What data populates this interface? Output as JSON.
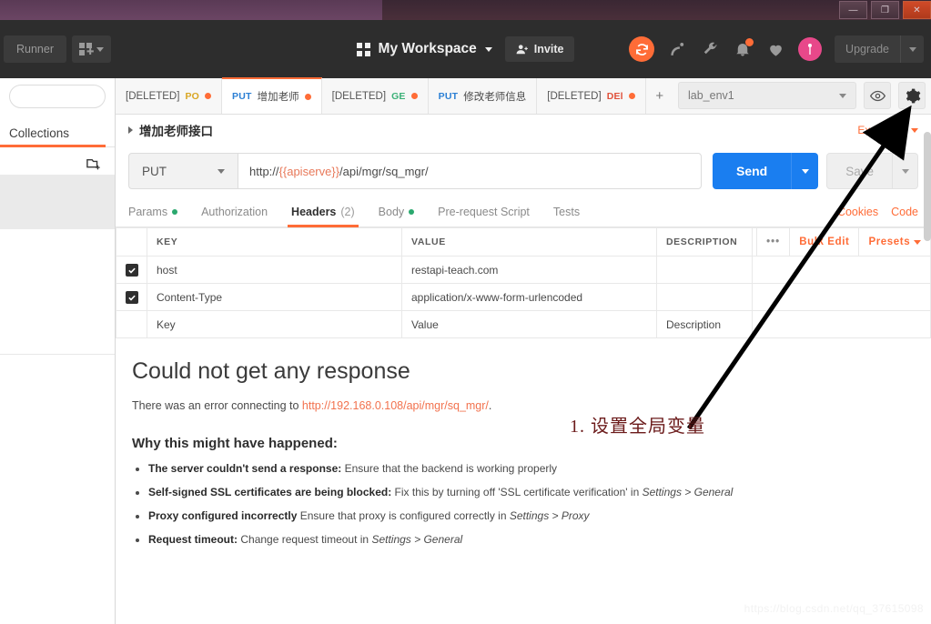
{
  "os_window": {
    "buttons": [
      {
        "name": "minimize",
        "glyph": "—"
      },
      {
        "name": "maximize",
        "glyph": "❐"
      },
      {
        "name": "close",
        "glyph": "✕"
      }
    ]
  },
  "header": {
    "runner_label": "Runner",
    "import_label": "",
    "workspace_label": "My Workspace",
    "invite_label": "Invite",
    "upgrade_label": "Upgrade",
    "icons": [
      "sync-icon",
      "satellite-icon",
      "wrench-icon",
      "bell-icon",
      "heart-icon",
      "avatar-icon"
    ],
    "accent_orange": "#ff6c37",
    "avatar_color": "#e8488a"
  },
  "sidebar": {
    "search_placeholder": "",
    "tab_label": "Collections",
    "new_folder_icon": "new-folder-icon"
  },
  "request_tabs": [
    {
      "method": "",
      "deleted_label": "[DELETED]",
      "method_tag": "PO",
      "name": "",
      "unsaved": true,
      "active": false,
      "method_class": "post"
    },
    {
      "method": "PUT",
      "deleted_label": "",
      "method_tag": "",
      "name": "增加老师",
      "unsaved": true,
      "active": true,
      "method_class": "put"
    },
    {
      "method": "",
      "deleted_label": "[DELETED]",
      "method_tag": "GE",
      "name": "",
      "unsaved": true,
      "active": false,
      "method_class": "get"
    },
    {
      "method": "PUT",
      "deleted_label": "",
      "method_tag": "",
      "name": "修改老师信息",
      "unsaved": false,
      "active": false,
      "method_class": "put"
    },
    {
      "method": "",
      "deleted_label": "[DELETED]",
      "method_tag": "DEl",
      "name": "",
      "unsaved": true,
      "active": false,
      "method_class": "del"
    }
  ],
  "tab_controls": {
    "add": "+",
    "more": "•••"
  },
  "environment": {
    "selected": "lab_env1",
    "eye_icon": "eye-icon",
    "gear_icon": "gear-icon"
  },
  "request": {
    "title": "增加老师接口",
    "examples_label": "Examples",
    "method": "PUT",
    "url_prefix": "http://",
    "url_variable": "{{apiserve}}",
    "url_suffix": "/api/mgr/sq_mgr/",
    "send_label": "Send",
    "save_label": "Save"
  },
  "subtabs": [
    {
      "label": "Params",
      "dot": true,
      "count": "",
      "active": false
    },
    {
      "label": "Authorization",
      "dot": false,
      "count": "",
      "active": false
    },
    {
      "label": "Headers",
      "dot": false,
      "count": "(2)",
      "active": true
    },
    {
      "label": "Body",
      "dot": true,
      "count": "",
      "active": false
    },
    {
      "label": "Pre-request Script",
      "dot": false,
      "count": "",
      "active": false
    },
    {
      "label": "Tests",
      "dot": false,
      "count": "",
      "active": false
    }
  ],
  "subtabs_right": [
    {
      "label": "Cookies"
    },
    {
      "label": "Code"
    }
  ],
  "headers_table": {
    "columns": [
      "KEY",
      "VALUE",
      "DESCRIPTION"
    ],
    "tools": {
      "dots": "•••",
      "bulk_edit": "Bulk Edit",
      "presets": "Presets"
    },
    "rows": [
      {
        "checked": true,
        "key": "host",
        "value": "restapi-teach.com",
        "description": ""
      },
      {
        "checked": true,
        "key": "Content-Type",
        "value": "application/x-www-form-urlencoded",
        "description": ""
      }
    ],
    "placeholder_row": {
      "key": "Key",
      "value": "Value",
      "description": "Description"
    }
  },
  "response_error": {
    "title": "Could not get any response",
    "subtitle_prefix": "There was an error connecting to ",
    "subtitle_url": "http://192.168.0.108/api/mgr/sq_mgr/",
    "subtitle_suffix": ".",
    "reasons_heading": "Why this might have happened:",
    "reasons": [
      {
        "bold": "The server couldn't send a response:",
        "text": " Ensure that the backend is working properly",
        "italic": ""
      },
      {
        "bold": "Self-signed SSL certificates are being blocked:",
        "text": " Fix this by turning off 'SSL certificate verification' in ",
        "italic": "Settings > General"
      },
      {
        "bold": "Proxy configured incorrectly",
        "text": " Ensure that proxy is configured correctly in ",
        "italic": "Settings > Proxy"
      },
      {
        "bold": "Request timeout:",
        "text": " Change request timeout in ",
        "italic": "Settings > General"
      }
    ]
  },
  "annotation": {
    "text": "1. 设置全局变量",
    "color": "#6b1a1a",
    "arrow_color": "#000000"
  },
  "watermark": "https://blog.csdn.net/qq_37615098"
}
